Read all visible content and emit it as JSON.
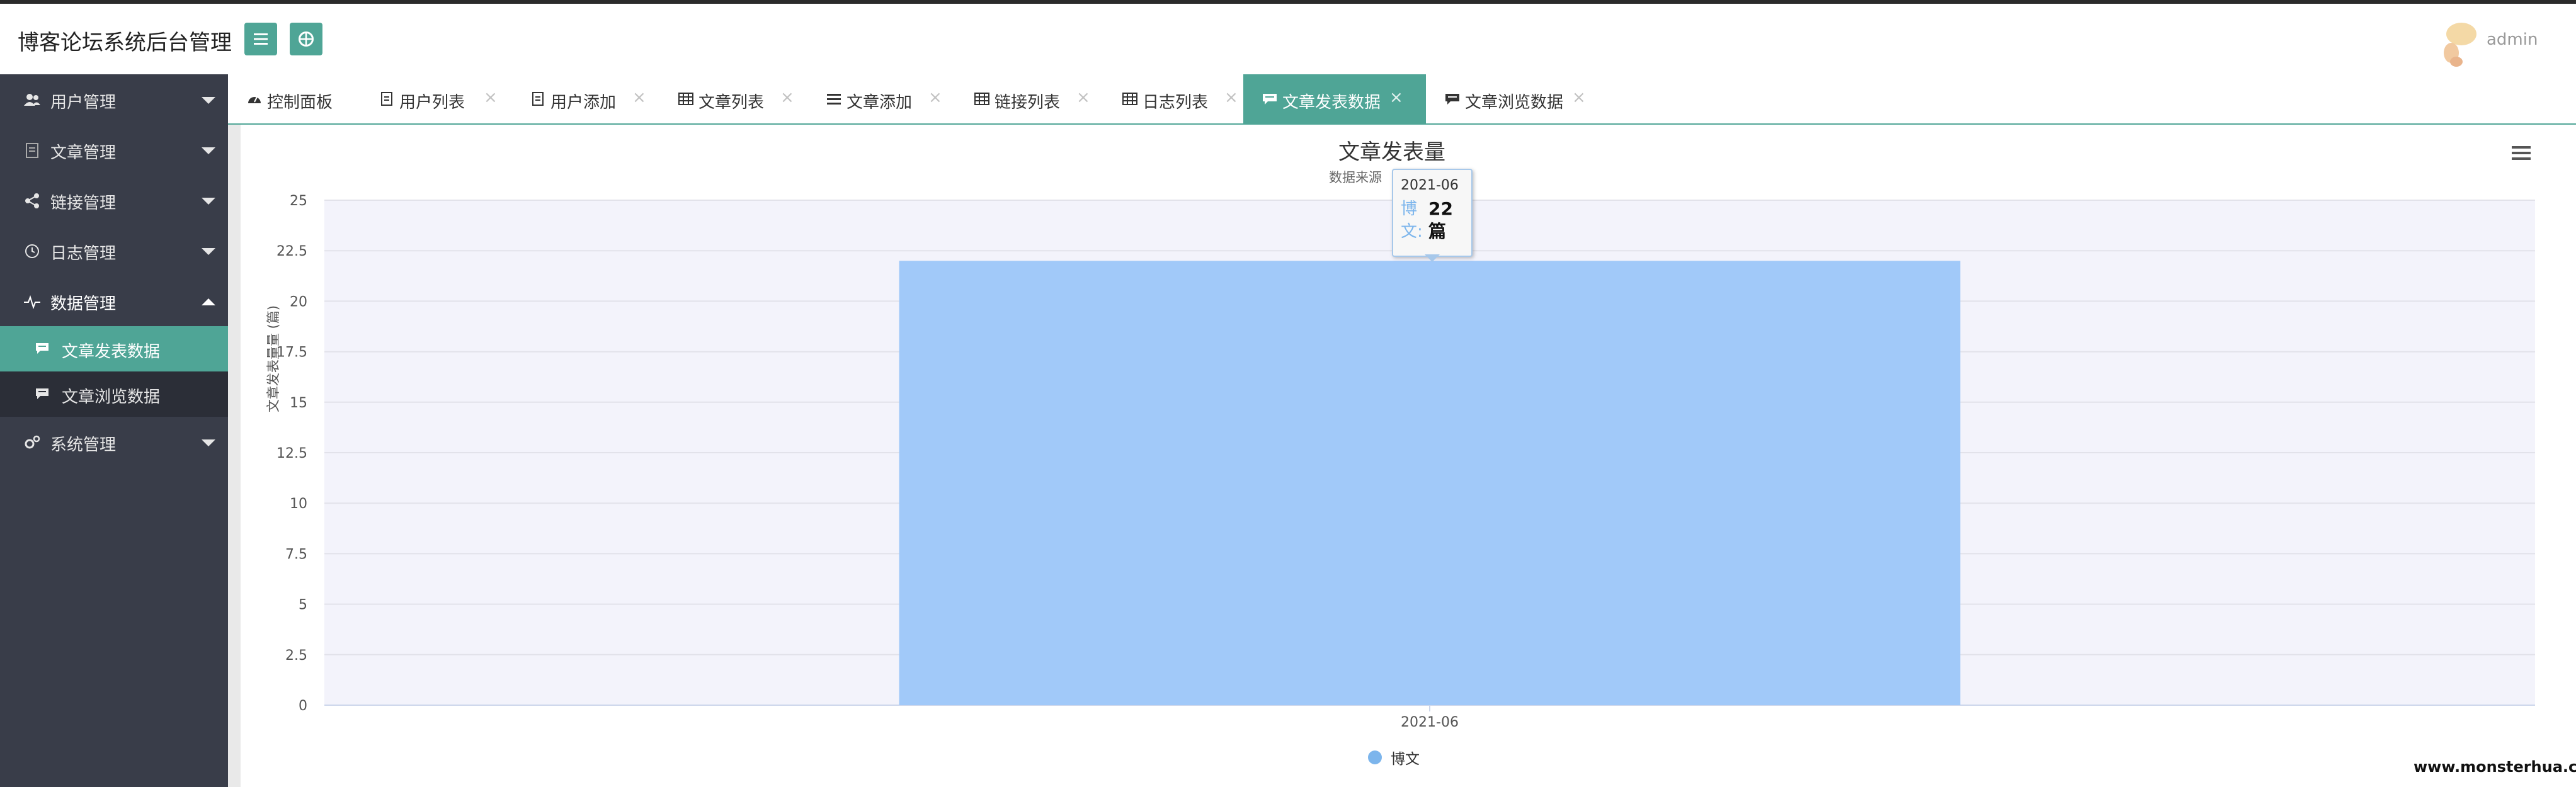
{
  "header": {
    "app_title": "博客论坛系统后台管理",
    "menu_toggle_icon": "menu-icon",
    "globe_icon": "globe-icon",
    "username": "admin"
  },
  "sidebar": {
    "items": [
      {
        "label": "用户管理",
        "icon": "users-icon"
      },
      {
        "label": "文章管理",
        "icon": "document-icon"
      },
      {
        "label": "链接管理",
        "icon": "share-icon"
      },
      {
        "label": "日志管理",
        "icon": "clock-icon"
      },
      {
        "label": "数据管理",
        "icon": "pulse-icon",
        "expanded": true,
        "children": [
          {
            "label": "文章发表数据",
            "icon": "comment-icon",
            "active": true
          },
          {
            "label": "文章浏览数据",
            "icon": "comment-icon"
          }
        ]
      },
      {
        "label": "系统管理",
        "icon": "gears-icon"
      }
    ]
  },
  "tabs": [
    {
      "label": "控制面板",
      "icon": "dashboard-icon",
      "closable": false
    },
    {
      "label": "用户列表",
      "icon": "document-icon",
      "closable": true
    },
    {
      "label": "用户添加",
      "icon": "document-icon",
      "closable": true
    },
    {
      "label": "文章列表",
      "icon": "table-icon",
      "closable": true
    },
    {
      "label": "文章添加",
      "icon": "list-icon",
      "closable": true
    },
    {
      "label": "链接列表",
      "icon": "table-icon",
      "closable": true
    },
    {
      "label": "日志列表",
      "icon": "table-icon",
      "closable": true
    },
    {
      "label": "文章发表数据",
      "icon": "comment-icon",
      "closable": true,
      "active": true
    },
    {
      "label": "文章浏览数据",
      "icon": "comment-icon",
      "closable": true
    }
  ],
  "close_glyph": "×",
  "chart_data": {
    "type": "bar",
    "title": "文章发表量",
    "subtitle": "数据来源",
    "ylabel": "文章发表量量 (篇)",
    "xlabel": "",
    "categories": [
      "2021-06"
    ],
    "series": [
      {
        "name": "博文",
        "values": [
          22
        ]
      }
    ],
    "ylim": [
      0,
      25
    ],
    "yticks": [
      "0",
      "2.5",
      "5",
      "7.5",
      "10",
      "12.5",
      "15",
      "17.5",
      "20",
      "22.5",
      "25"
    ],
    "grid": true,
    "legend_position": "bottom",
    "colors": {
      "bar": "#a1c9f9",
      "plot_bg": "#f3f3fb",
      "series": "#7cb5ec"
    },
    "tooltip": {
      "x": "2021-06",
      "series": "博文",
      "value": "22",
      "unit": "篇"
    }
  },
  "watermark": "www.monsterhua.com"
}
